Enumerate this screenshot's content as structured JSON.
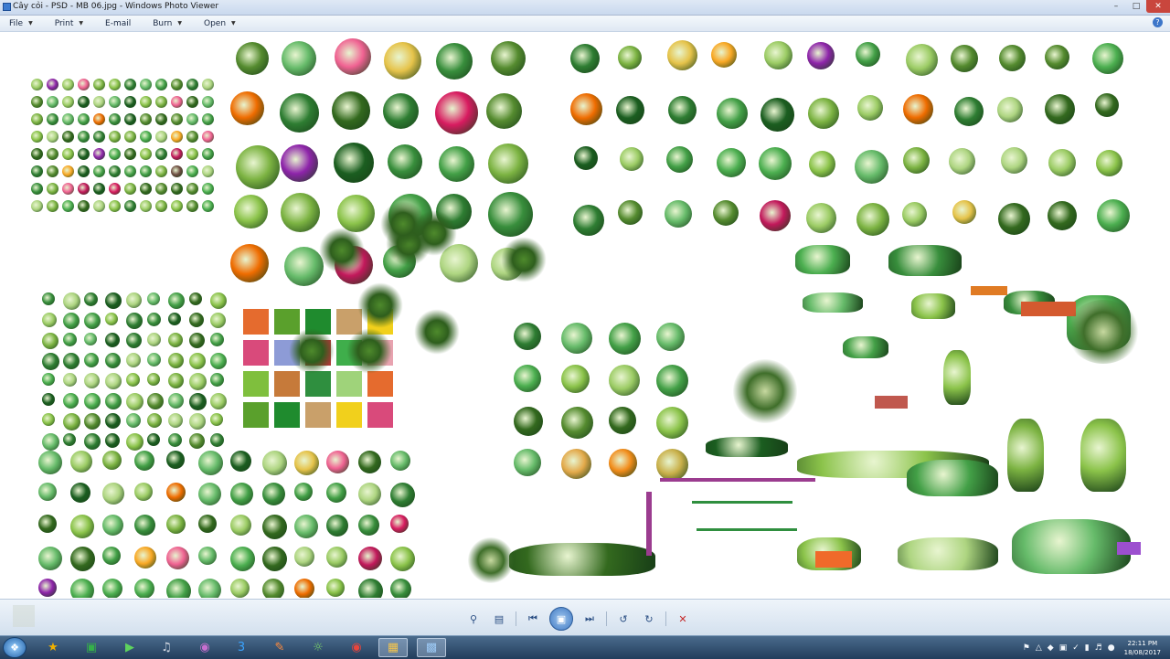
{
  "window": {
    "title": "Cây cỏi - PSD - MB 06.jpg - Windows Photo Viewer",
    "minimize_icon": "minimize-icon",
    "maximize_icon": "maximize-icon",
    "close_icon": "close-icon"
  },
  "menu": {
    "items": [
      {
        "label": "File",
        "icon": "chevron-down-icon"
      },
      {
        "label": "Print",
        "icon": "chevron-down-icon"
      },
      {
        "label": "E-mail",
        "icon": ""
      },
      {
        "label": "Burn",
        "icon": "chevron-down-icon"
      },
      {
        "label": "Open",
        "icon": "chevron-down-icon"
      }
    ],
    "help_icon": "help-icon"
  },
  "controls": {
    "zoom_icon": "zoom-icon",
    "fit_icon": "actual-size-icon",
    "prev_icon": "previous-icon",
    "slideshow_icon": "slideshow-icon",
    "next_icon": "next-icon",
    "rotate_ccw_icon": "rotate-counterclockwise-icon",
    "rotate_cw_icon": "rotate-clockwise-icon",
    "delete_icon": "delete-icon"
  },
  "taskbar": {
    "apps": [
      "explorer-icon",
      "photoshop-icon",
      "excel-icon",
      "camtasia-icon",
      "itunes-icon",
      "media-icon",
      "skype-icon",
      "paint-icon",
      "browser-icon",
      "chrome-icon",
      "folder-icon",
      "photo-viewer-icon"
    ],
    "clock_time": "22:11 PM",
    "clock_date": "18/08/2017"
  },
  "colors": {
    "accent": "#3f78c2",
    "taskbar": "#223d5c",
    "close": "#c9463d"
  }
}
